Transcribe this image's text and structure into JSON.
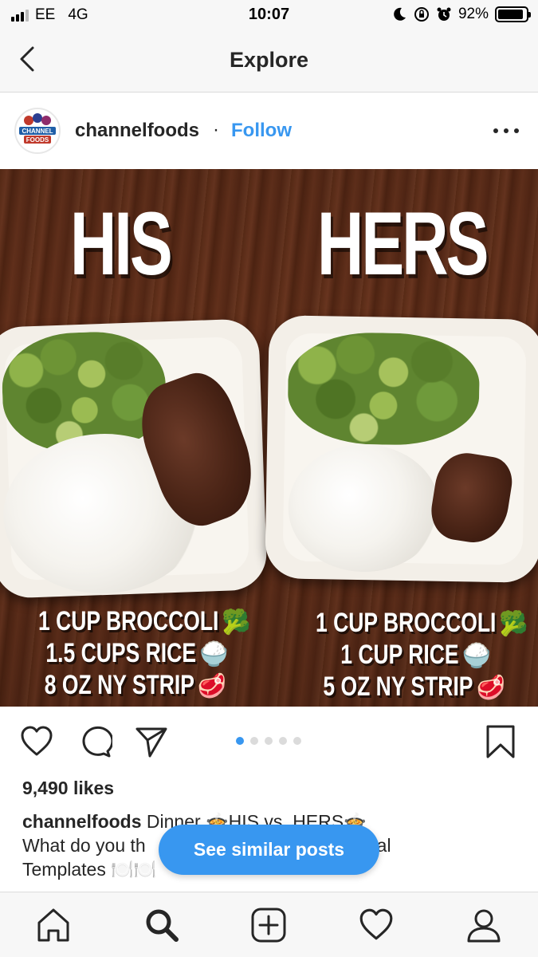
{
  "status_bar": {
    "carrier": "EE",
    "network": "4G",
    "time": "10:07",
    "battery_percent": "92%",
    "battery_level": 0.92
  },
  "nav": {
    "title": "Explore"
  },
  "post": {
    "author": "channelfoods",
    "separator": "·",
    "follow_label": "Follow",
    "avatar_text_line1": "CHANNEL",
    "avatar_text_line2": "FOODS",
    "image": {
      "left_title": "HIS",
      "right_title": "HERS",
      "left_lines": [
        {
          "text": "1 CUP BROCCOLI",
          "emoji": "🥦"
        },
        {
          "text": "1.5 CUPS RICE",
          "emoji": "🍚"
        },
        {
          "text": "8 OZ NY STRIP",
          "emoji": "🥩"
        }
      ],
      "right_lines": [
        {
          "text": "1 CUP BROCCOLI",
          "emoji": "🥦"
        },
        {
          "text": "1 CUP RICE",
          "emoji": "🍚"
        },
        {
          "text": "5 OZ NY STRIP",
          "emoji": "🥩"
        }
      ]
    },
    "carousel": {
      "count": 5,
      "active_index": 0
    },
    "likes": "9,490 likes",
    "caption_author": "channelfoods",
    "caption_line1": " Dinner 🍲HIS vs. HERS🍲",
    "caption_line2": "What do you th",
    "caption_line2_tail": "Meal",
    "caption_line3": "Templates 🍽️🍽️"
  },
  "similar_posts_label": "See similar posts",
  "colors": {
    "accent": "#3897f0",
    "text": "#262626",
    "bar_bg": "#f7f7f7"
  }
}
